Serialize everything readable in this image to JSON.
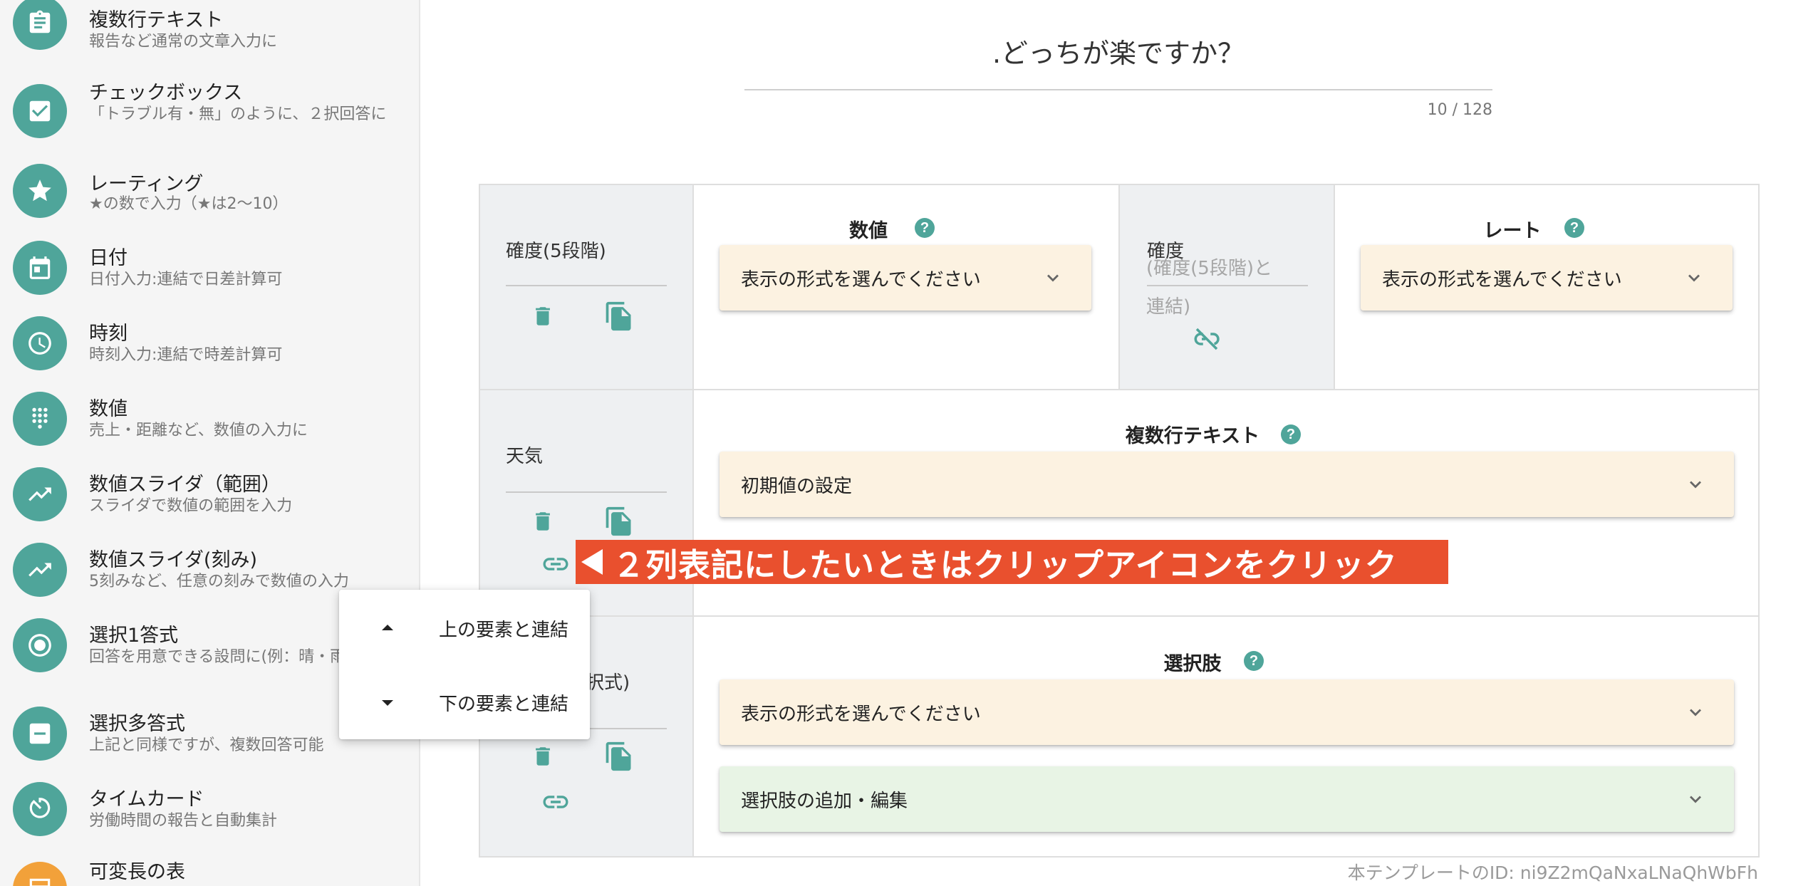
{
  "sidebar": {
    "items": [
      {
        "title": "複数行テキスト",
        "desc": "報告など通常の文章入力に",
        "icon": "clipboard-icon"
      },
      {
        "title": "チェックボックス",
        "desc": "「トラブル有・無」のように、２択回答に",
        "icon": "checkbox-icon"
      },
      {
        "title": "レーティング",
        "desc": "★の数で入力（★は2〜10）",
        "icon": "star-icon"
      },
      {
        "title": "日付",
        "desc": "日付入力:連結で日差計算可",
        "icon": "calendar-icon"
      },
      {
        "title": "時刻",
        "desc": "時刻入力:連結で時差計算可",
        "icon": "clock-icon"
      },
      {
        "title": "数値",
        "desc": "売上・距離など、数値の入力に",
        "icon": "dialpad-icon"
      },
      {
        "title": "数値スライダ（範囲）",
        "desc": "スライダで数値の範囲を入力",
        "icon": "trending-up-icon"
      },
      {
        "title": "数値スライダ(刻み)",
        "desc": "5刻みなど、任意の刻みで数値の入力",
        "icon": "trending-up-icon"
      },
      {
        "title": "選択1答式",
        "desc": "回答を用意できる設問に(例：晴・雨・雪)",
        "icon": "radio-button-icon"
      },
      {
        "title": "選択多答式",
        "desc": "上記と同様ですが、複数回答可能",
        "icon": "multi-select-icon"
      },
      {
        "title": "タイムカード",
        "desc": "労働時間の報告と自動集計",
        "icon": "timer-icon"
      },
      {
        "title": "可変長の表",
        "desc": "",
        "icon": "table-icon"
      }
    ]
  },
  "form": {
    "title": ".どっちが楽ですか？",
    "counter": "10 / 128"
  },
  "rows": {
    "r1": {
      "left_label": "確度(5段階)",
      "section": "数値",
      "select": "表示の形式を選んでください",
      "mid_label": "確度",
      "mid_note": "(確度(5段階)と連結)",
      "section2": "レート",
      "select2": "表示の形式を選んでください"
    },
    "r2": {
      "left_label": "天気",
      "section": "複数行テキスト",
      "select": "初期値の設定"
    },
    "r3": {
      "left_label": "択式)",
      "section": "選択肢",
      "select": "表示の形式を選んでください",
      "select_choices": "選択肢の追加・編集"
    }
  },
  "help_glyph": "?",
  "annotation": "２列表記にしたいときはクリップアイコンをクリック",
  "context_menu": {
    "items": [
      {
        "label": "上の要素と連結"
      },
      {
        "label": "下の要素と連結"
      }
    ]
  },
  "footer": {
    "template_id": "本テンプレートのID: ni9Z2mQaNxaLNaQhWbFh"
  },
  "colors": {
    "accent": "#4fa59a",
    "banner": "#e9502e",
    "select_cream": "#fcf2e1",
    "select_mint": "#e8f4e5"
  }
}
